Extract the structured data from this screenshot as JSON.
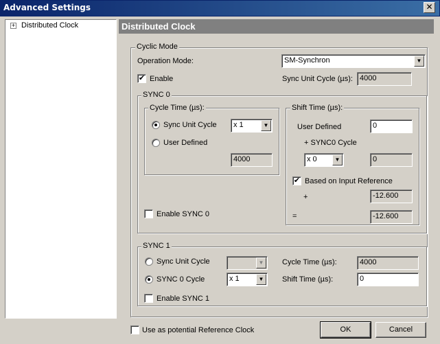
{
  "window": {
    "title": "Advanced Settings",
    "close_glyph": "✕"
  },
  "tree": {
    "expander": "+",
    "items": [
      {
        "label": "Distributed Clock"
      }
    ]
  },
  "panel": {
    "title": "Distributed Clock"
  },
  "cyclic_mode": {
    "group_label": "Cyclic Mode",
    "operation_mode_label": "Operation Mode:",
    "operation_mode_value": "SM-Synchron",
    "enable_label": "Enable",
    "enable_checked": true,
    "sync_unit_cycle_label": "Sync Unit Cycle (µs):",
    "sync_unit_cycle_value": "4000"
  },
  "sync0": {
    "group_label": "SYNC 0",
    "cycle_time": {
      "group_label": "Cycle Time (µs):",
      "sync_unit_cycle_label": "Sync Unit Cycle",
      "multiplier_value": "x 1",
      "user_defined_label": "User Defined",
      "value": "4000"
    },
    "shift_time": {
      "group_label": "Shift Time (µs):",
      "user_defined_label": "User Defined",
      "user_defined_value": "0",
      "sync0_cycle_label": "+ SYNC0 Cycle",
      "multiplier_value": "x 0",
      "multiplier_result": "0",
      "based_on_input_label": "Based on Input Reference",
      "plus_label": "+",
      "plus_value": "-12.600",
      "equals_label": "=",
      "equals_value": "-12.600"
    },
    "enable_label": "Enable SYNC 0"
  },
  "sync1": {
    "group_label": "SYNC 1",
    "sync_unit_cycle_label": "Sync Unit Cycle",
    "sync0_cycle_label": "SYNC 0 Cycle",
    "multiplier_value": "x 1",
    "cycle_time_label": "Cycle Time (µs):",
    "cycle_time_value": "4000",
    "shift_time_label": "Shift Time (µs):",
    "shift_time_value": "0",
    "enable_label": "Enable SYNC 1"
  },
  "footer": {
    "reference_clock_label": "Use as potential Reference Clock",
    "ok_label": "OK",
    "cancel_label": "Cancel"
  },
  "glyphs": {
    "check": "✔",
    "dropdown": "▼"
  },
  "colors": {
    "titlebar": "#0a246a",
    "panel_header": "#808080",
    "face": "#d4d0c8"
  }
}
